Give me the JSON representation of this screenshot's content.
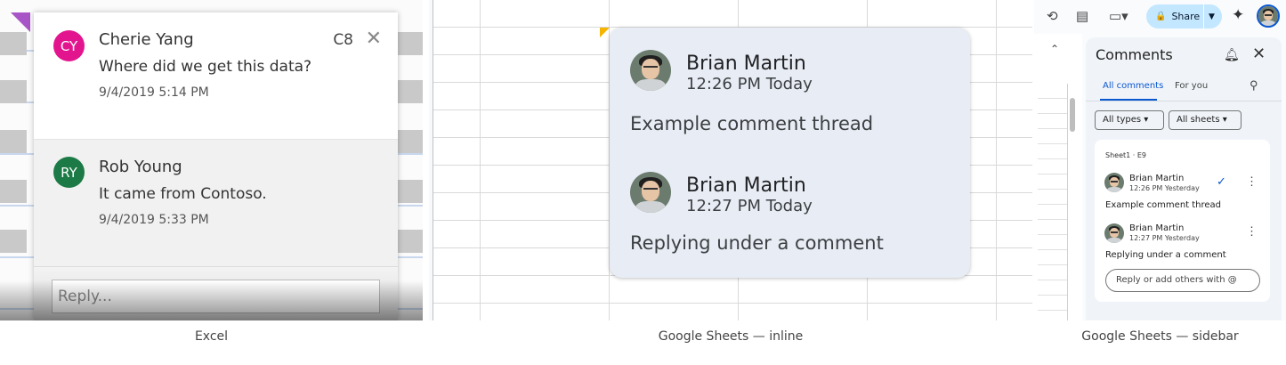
{
  "excel": {
    "caption": "Excel",
    "cell_ref": "C8",
    "reply_placeholder": "Reply...",
    "comments": [
      {
        "initials": "CY",
        "author": "Cherie Yang",
        "text": "Where did we get this data?",
        "timestamp": "9/4/2019 5:14 PM",
        "avatar_color": "#e3158e"
      },
      {
        "initials": "RY",
        "author": "Rob Young",
        "text": "It came from Contoso.",
        "timestamp": "9/4/2019 5:33 PM",
        "avatar_color": "#1b7a45"
      }
    ]
  },
  "inline": {
    "caption": "Google Sheets — inline",
    "comments": [
      {
        "author": "Brian Martin",
        "time": "12:26 PM Today",
        "text": "Example comment thread"
      },
      {
        "author": "Brian Martin",
        "time": "12:27 PM Today",
        "text": "Replying under a comment"
      }
    ]
  },
  "sidebar": {
    "caption": "Google Sheets — sidebar",
    "share_label": "Share",
    "title": "Comments",
    "tabs": [
      "All comments",
      "For you"
    ],
    "filters": [
      "All types",
      "All sheets"
    ],
    "sheet_ref": "Sheet1 · E9",
    "comments": [
      {
        "author": "Brian Martin",
        "time": "12:26 PM Yesterday",
        "text": "Example comment thread"
      },
      {
        "author": "Brian Martin",
        "time": "12:27 PM Yesterday",
        "text": "Replying under a comment"
      }
    ],
    "reply_placeholder": "Reply or add others with @",
    "accent_color": "#0b57d0"
  }
}
